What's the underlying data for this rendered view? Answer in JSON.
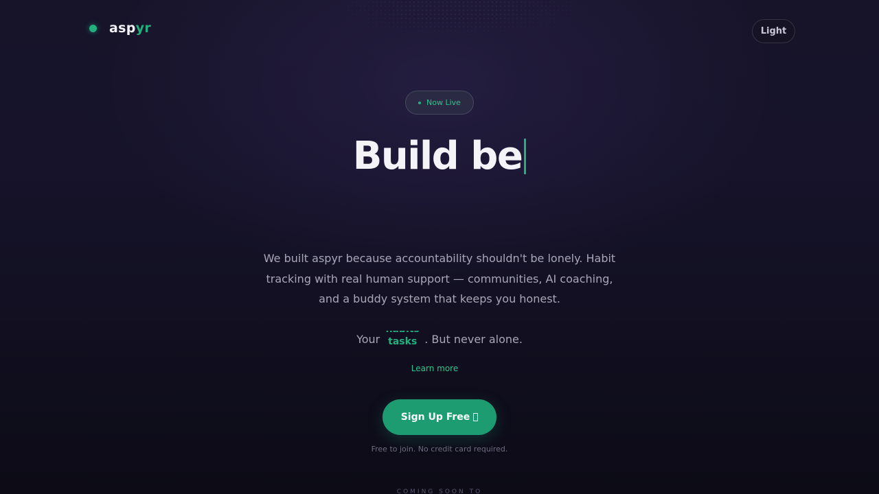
{
  "header": {
    "logo_prefix": "asp",
    "logo_accent": "yr",
    "theme_toggle_label": "Light"
  },
  "hero": {
    "badge_label": "Now Live",
    "title_typed": "Build be",
    "description": "We built aspyr because accountability shouldn't be lonely. Habit tracking with real human support — communities, AI coaching, and a buddy system that keeps you honest.",
    "tagline_before": "Your",
    "tagline_words": [
      "habits",
      "tasks"
    ],
    "tagline_after": ". But never alone.",
    "learn_more_label": "Learn more",
    "cta_label": "Sign Up Free",
    "cta_note": "Free to join. No credit card required.",
    "coming_soon_label": "COMING SOON TO"
  },
  "colors": {
    "accent": "#22b07d",
    "button": "#1d9c72",
    "background": "#16132a"
  },
  "icons": {
    "cta_icon": "arrow-right-icon"
  }
}
